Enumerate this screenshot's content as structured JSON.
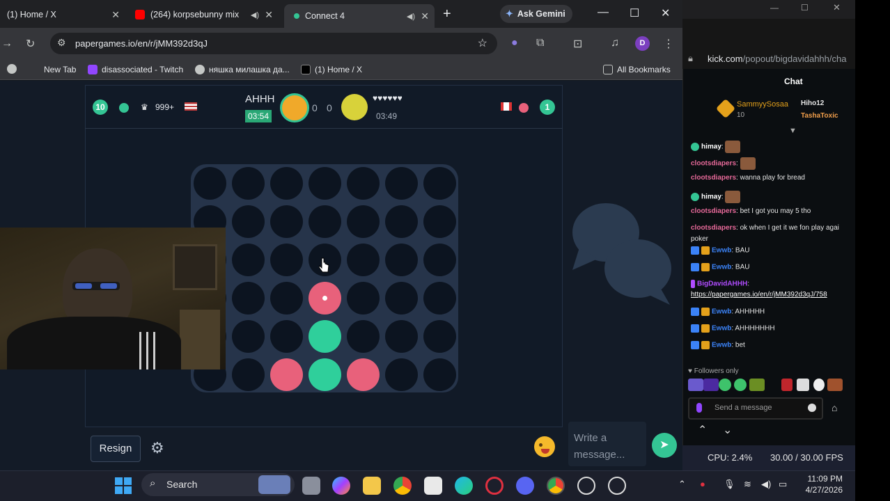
{
  "browser": {
    "tabs": [
      {
        "label": "(1) Home / X"
      },
      {
        "label": "(264) korpsebunny mix"
      },
      {
        "label": "Connect 4"
      }
    ],
    "ask_gemini": "Ask Gemini",
    "url": "papergames.io/en/r/jMM392d3qJ",
    "profile_initial": "D",
    "bookmarks": [
      {
        "label": "New Tab"
      },
      {
        "label": "disassociated - Twitch"
      },
      {
        "label": "няшка милашка да..."
      },
      {
        "label": "(1) Home / X"
      }
    ],
    "all_bookmarks": "All Bookmarks"
  },
  "game": {
    "left_player": {
      "level": "10",
      "rating": "999+"
    },
    "current_player_name": "AHHH",
    "current_timer": "03:54",
    "score_left": "0",
    "score_right": "0",
    "opponent_name": "♥♥♥♥♥♥",
    "opponent_timer": "03:49",
    "right_level": "1",
    "board": {
      "rows": 6,
      "cols": 7,
      "pieces": [
        {
          "row": 3,
          "col": 3,
          "color": "red",
          "last_move": true
        },
        {
          "row": 4,
          "col": 3,
          "color": "green"
        },
        {
          "row": 5,
          "col": 2,
          "color": "red"
        },
        {
          "row": 5,
          "col": 3,
          "color": "green"
        },
        {
          "row": 5,
          "col": 4,
          "color": "red"
        }
      ]
    },
    "resign_label": "Resign",
    "chat_placeholder": "Write a message...",
    "colors": {
      "red": "#e8617b",
      "green": "#2fcf9b",
      "empty": "#0c1420",
      "board": "#26344a"
    }
  },
  "kick": {
    "url_domain": "kick.com",
    "url_path": "/popout/bigdavidahhh/cha",
    "chat_title": "Chat",
    "top_gifters": [
      {
        "name": "SammyySosaa",
        "count": "10"
      },
      {
        "name": "Hiho12"
      },
      {
        "name": "TashaToxic"
      }
    ],
    "messages": [
      {
        "user": "himay",
        "text": ""
      },
      {
        "user": "clootsdiapers",
        "text": ""
      },
      {
        "user": "clootsdiapers",
        "text": "wanna play for bread"
      },
      {
        "user": "himay",
        "text": ""
      },
      {
        "user": "clootsdiapers",
        "text": "bet I got you may 5 tho"
      },
      {
        "user": "clootsdiapers",
        "text": "ok when I get it we fon play agai",
        "cont": "poker"
      },
      {
        "user": "Ewwb",
        "text": "BAU"
      },
      {
        "user": "Ewwb",
        "text": "BAU"
      },
      {
        "user": "BigDavidAHHH",
        "text": "",
        "link": "https://papergames.io/en/r/jMM392d3qJ/758"
      },
      {
        "user": "Ewwb",
        "text": "AHHHHH"
      },
      {
        "user": "Ewwb",
        "text": "AHHHHHHH"
      },
      {
        "user": "Ewwb",
        "text": "bet"
      }
    ],
    "followers_only": "Followers only",
    "send_placeholder": "Send a message",
    "cpu": "CPU: 2.4%",
    "fps": "30.00 / 30.00 FPS"
  },
  "taskbar": {
    "search_label": "Search",
    "time": "11:09 PM",
    "date": "4/27/2026"
  }
}
